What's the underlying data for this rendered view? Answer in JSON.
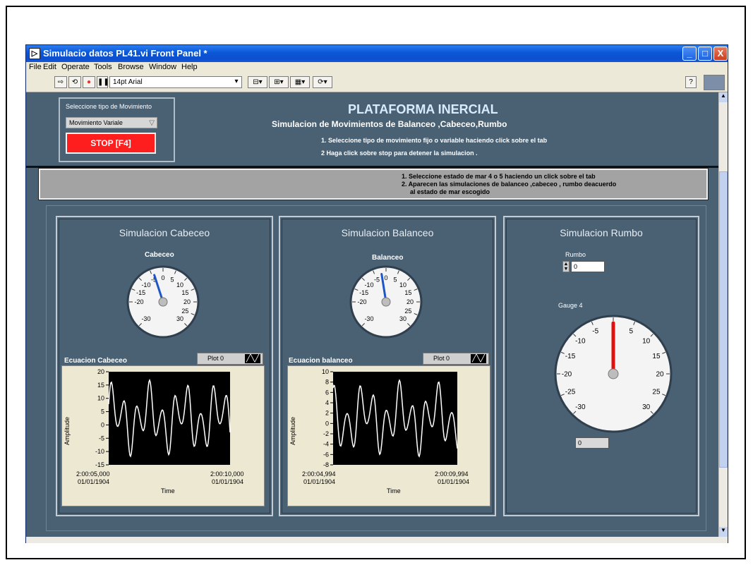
{
  "window": {
    "title": "Simulacio datos PL41.vi Front Panel *",
    "controls": {
      "minimize": "_",
      "maximize": "□",
      "close": "X"
    }
  },
  "menu": [
    "File",
    "Edit",
    "Operate",
    "Tools",
    "Browse",
    "Window",
    "Help"
  ],
  "toolbar": {
    "font": "14pt Arial",
    "help": "?"
  },
  "control_box": {
    "label": "Seleccione tipo de Movimiento",
    "selector_value": "Movimiento Variale",
    "stop_label": "STOP [F4]"
  },
  "header": {
    "title": "PLATAFORMA INERCIAL",
    "subtitle": "Simulacion de Movimientos de Balanceo ,Cabeceo,Rumbo",
    "instruction_1": "1. Seleccione tipo de movimiento fijo o variable  haciendo click sobre el tab",
    "instruction_2": "2  Haga click sobre stop para detener la simulacion ."
  },
  "info": {
    "line_1": "1. Seleccione estado de mar 4 o 5  haciendo un click sobre el tab",
    "line_2": "2. Aparecen las simulaciones de balanceo ,cabeceo , rumbo deacuerdo",
    "line_3": "al estado  de mar escogido"
  },
  "cabeceo": {
    "title": "Simulacion Cabeceo",
    "gauge_label": "Cabeceo",
    "gauge_ticks": [
      "-30",
      "-20",
      "-15",
      "-10",
      "-5",
      "0",
      "5",
      "10",
      "15",
      "20",
      "25",
      "30"
    ],
    "gauge_value": -4,
    "graph_name": "Ecuacion Cabeceo",
    "legend": "Plot 0",
    "y_ticks": [
      "20",
      "15",
      "10",
      "5",
      "0",
      "-5",
      "-10",
      "-15"
    ],
    "y_label": "Amplitude",
    "x_start_time": "2:00:05,000",
    "x_start_date": "01/01/1904",
    "x_end_time": "2:00:10,000",
    "x_end_date": "01/01/1904",
    "x_label": "Time"
  },
  "balanceo": {
    "title": "Simulacion Balanceo",
    "gauge_label": "Balanceo",
    "gauge_ticks": [
      "-30",
      "-20",
      "-15",
      "-10",
      "-5",
      "0",
      "5",
      "10",
      "15",
      "20",
      "25",
      "30"
    ],
    "gauge_value": -2,
    "graph_name": "Ecuacion balanceo",
    "legend": "Plot 0",
    "y_ticks": [
      "10",
      "8",
      "6",
      "4",
      "2",
      "0",
      "-2",
      "-4",
      "-6",
      "-8"
    ],
    "y_label": "Amplitude",
    "x_start_time": "2:00:04,994",
    "x_start_date": "01/01/1904",
    "x_end_time": "2:00:09,994",
    "x_end_date": "01/01/1904",
    "x_label": "Time"
  },
  "rumbo": {
    "title": "Simulacion Rumbo",
    "control_label": "Rumbo",
    "control_value": "0",
    "gauge_label": "Gauge 4",
    "gauge_ticks": [
      "-30",
      "-25",
      "-20",
      "-15",
      "-10",
      "-5",
      "0",
      "5",
      "10",
      "15",
      "20",
      "25",
      "30"
    ],
    "gauge_value": 0,
    "indicator_value": "0"
  },
  "colors": {
    "panel": "#4a6073",
    "stop": "#ff1e1e",
    "cabeceo_needle": "#1e56c8",
    "rumbo_needle": "#e01010"
  }
}
